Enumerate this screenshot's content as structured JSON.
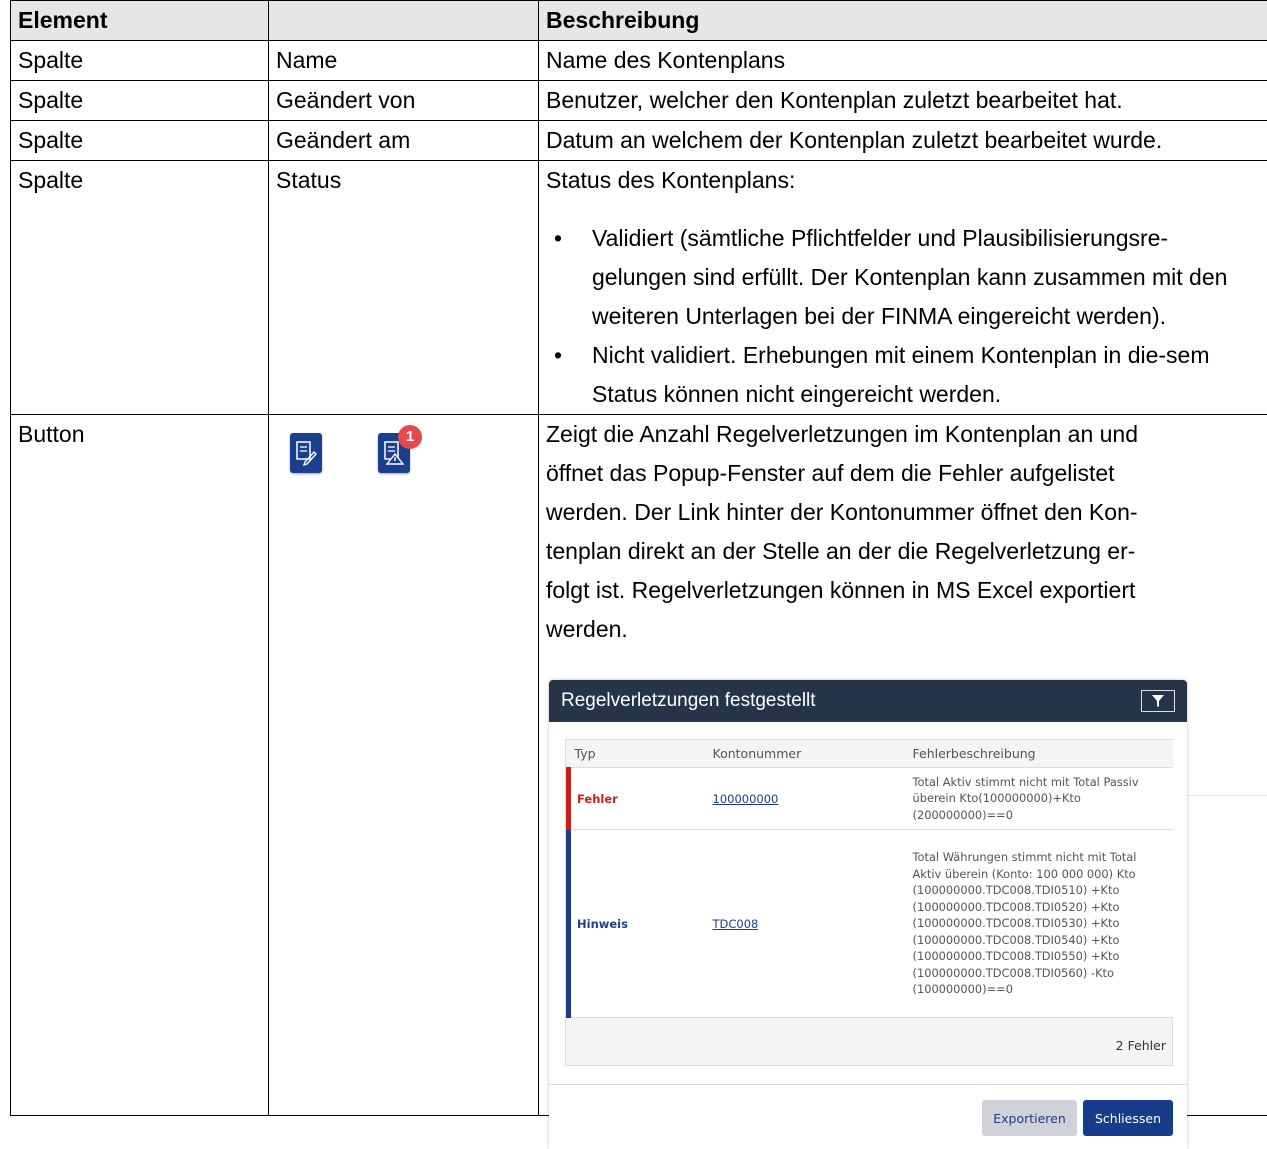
{
  "table": {
    "headers": [
      "Element",
      "",
      "Beschreibung"
    ],
    "rows": [
      {
        "element": "Spalte",
        "name": "Name",
        "desc": "Name des Kontenplans"
      },
      {
        "element": "Spalte",
        "name": "Geändert von",
        "desc": "Benutzer, welcher den Kontenplan zuletzt bearbeitet hat."
      },
      {
        "element": "Spalte",
        "name": "Geändert am",
        "desc": "Datum an welchem der Kontenplan zuletzt bearbeitet wurde."
      },
      {
        "element": "Spalte",
        "name": "Status",
        "desc": "Status des Kontenplans:",
        "bullets": [
          "Validiert (sämtliche Pflichtfelder und Plausibilisierungsre-gelungen sind erfüllt. Der Kontenplan kann zusammen mit den weiteren Unterlagen bei der FINMA eingereicht werden).",
          "Nicht validiert. Erhebungen mit einem Kontenplan in die-sem Status können nicht eingereicht werden."
        ]
      },
      {
        "element": "Button",
        "name": "",
        "desc_lines": [
          "Zeigt die Anzahl Regelverletzungen im Kontenplan an und",
          "öffnet das Popup-Fenster auf dem die Fehler aufgelistet",
          "werden. Der Link hinter der Kontonummer öffnet den Kon-",
          "tenplan direkt an der Stelle an der die Regelverletzung er-",
          "folgt ist. Regelverletzungen können in MS Excel exportiert",
          "werden."
        ],
        "badge_count": "1"
      }
    ]
  },
  "dialog": {
    "title": "Regelverletzungen festgestellt",
    "columns": [
      "Typ",
      "Kontonummer",
      "Fehlerbeschreibung"
    ],
    "rows": [
      {
        "type": "Fehler",
        "account": "100000000",
        "desc_lines": [
          "Total Aktiv stimmt nicht mit Total Passiv",
          "überein Kto(100000000)+Kto",
          "(200000000)==0"
        ]
      },
      {
        "type": "Hinweis",
        "account": "TDC008",
        "desc_lines": [
          "Total Währungen stimmt nicht mit Total",
          "Aktiv überein (Konto: 100 000 000) Kto",
          "(100000000.TDC008.TDI0510) +Kto",
          "(100000000.TDC008.TDI0520) +Kto",
          "(100000000.TDC008.TDI0530) +Kto",
          "(100000000.TDC008.TDI0540) +Kto",
          "(100000000.TDC008.TDI0550) +Kto",
          "(100000000.TDC008.TDI0560) -Kto",
          "(100000000)==0"
        ]
      }
    ],
    "count_label": "2 Fehler",
    "export_label": "Exportieren",
    "close_label": "Schliessen",
    "colors": {
      "header": "#26344a",
      "error": "#c81e1e",
      "hint": "#1f3d8a",
      "primary": "#183c8c"
    }
  },
  "icons": [
    "report-edit-icon",
    "report-warning-icon"
  ]
}
